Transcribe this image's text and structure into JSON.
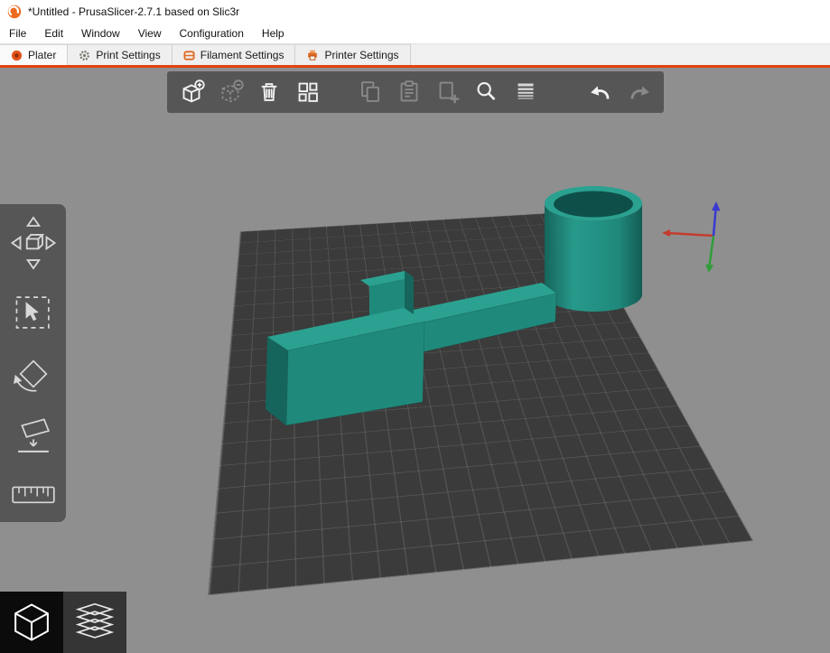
{
  "window": {
    "title": "*Untitled - PrusaSlicer-2.7.1 based on Slic3r"
  },
  "menubar": {
    "items": [
      "File",
      "Edit",
      "Window",
      "View",
      "Configuration",
      "Help"
    ]
  },
  "tabbar": {
    "tabs": [
      {
        "label": "Plater",
        "icon": "plater-icon",
        "active": true
      },
      {
        "label": "Print Settings",
        "icon": "gear-icon",
        "active": false
      },
      {
        "label": "Filament Settings",
        "icon": "filament-icon",
        "active": false
      },
      {
        "label": "Printer Settings",
        "icon": "printer-icon",
        "active": false
      }
    ]
  },
  "viewport_toolbar": {
    "icons": [
      {
        "name": "add-object",
        "enabled": true
      },
      {
        "name": "delete-object",
        "enabled": false
      },
      {
        "name": "delete-all",
        "enabled": true
      },
      {
        "name": "arrange",
        "enabled": true
      },
      {
        "name": "copy",
        "enabled": false
      },
      {
        "name": "paste",
        "enabled": false
      },
      {
        "name": "add-instance",
        "enabled": false
      },
      {
        "name": "search",
        "enabled": true
      },
      {
        "name": "variable-layer-height",
        "enabled": true
      },
      {
        "name": "undo",
        "enabled": true
      },
      {
        "name": "redo",
        "enabled": false
      }
    ]
  },
  "gizmo_toolbar": {
    "icons": [
      "move-gizmo",
      "select-box",
      "rotate-gizmo",
      "place-on-face",
      "measure-ruler"
    ]
  },
  "view_buttons": [
    "3d-editor-view",
    "preview-view"
  ],
  "scene": {
    "bed_color": "#3b3b3b",
    "grid_color": "#5e5e5e",
    "model_color": "#1f8a7c",
    "model_top_color": "#2ba191",
    "model_dark_color": "#15655c",
    "axes": {
      "x": "#c43c2e",
      "y": "#2f9e38",
      "z": "#3a3ad0"
    }
  },
  "colors": {
    "accent_orange": "#ed6b21",
    "tab_underline": "#e1430e",
    "viewport_bg": "#8f8f8f",
    "toolbar_bg": "rgba(73,73,73,0.82)"
  }
}
